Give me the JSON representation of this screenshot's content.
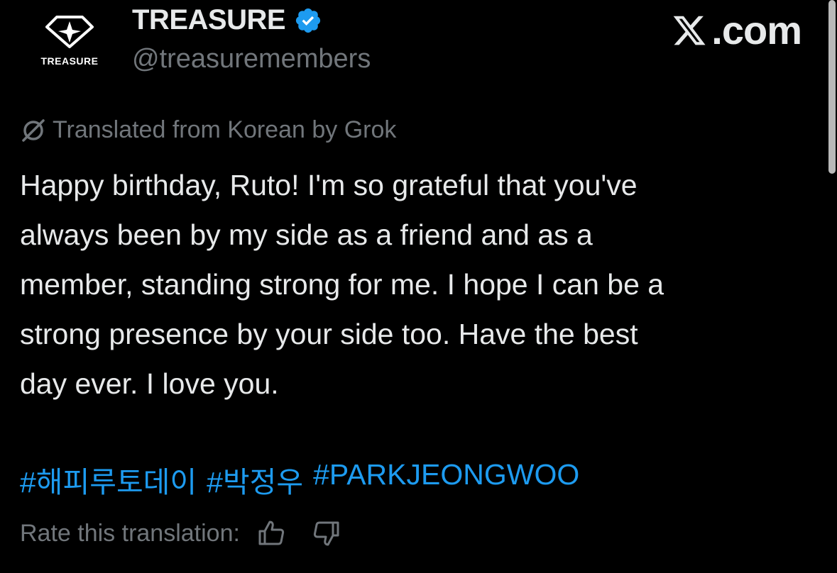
{
  "author": {
    "avatar_label": "TREASURE",
    "display_name": "TREASURE",
    "verified_icon": "verified-badge-icon",
    "handle": "@treasuremembers"
  },
  "brand": {
    "label": ".com",
    "logo_icon": "x-logo-icon"
  },
  "translation": {
    "icon": "grok-icon",
    "label": "Translated from Korean by Grok"
  },
  "post": {
    "lines": [
      "Happy birthday, Ruto! I'm so grateful that you've",
      "always been by my side as a friend and as a",
      "member, standing strong for me. I hope I can be a",
      "strong presence by your side too. Have the best",
      "day ever. I love you."
    ],
    "hashtags": [
      "#해피루토데이",
      "#박정우",
      "#PARKJEONGWOO"
    ]
  },
  "rating": {
    "label": "Rate this translation:",
    "thumbs_up_icon": "thumbs-up-icon",
    "thumbs_down_icon": "thumbs-down-icon"
  },
  "colors": {
    "background": "#000000",
    "text": "#e7e9ea",
    "secondary": "#71767b",
    "link": "#1d9bf0",
    "verified": "#1d9bf0"
  }
}
